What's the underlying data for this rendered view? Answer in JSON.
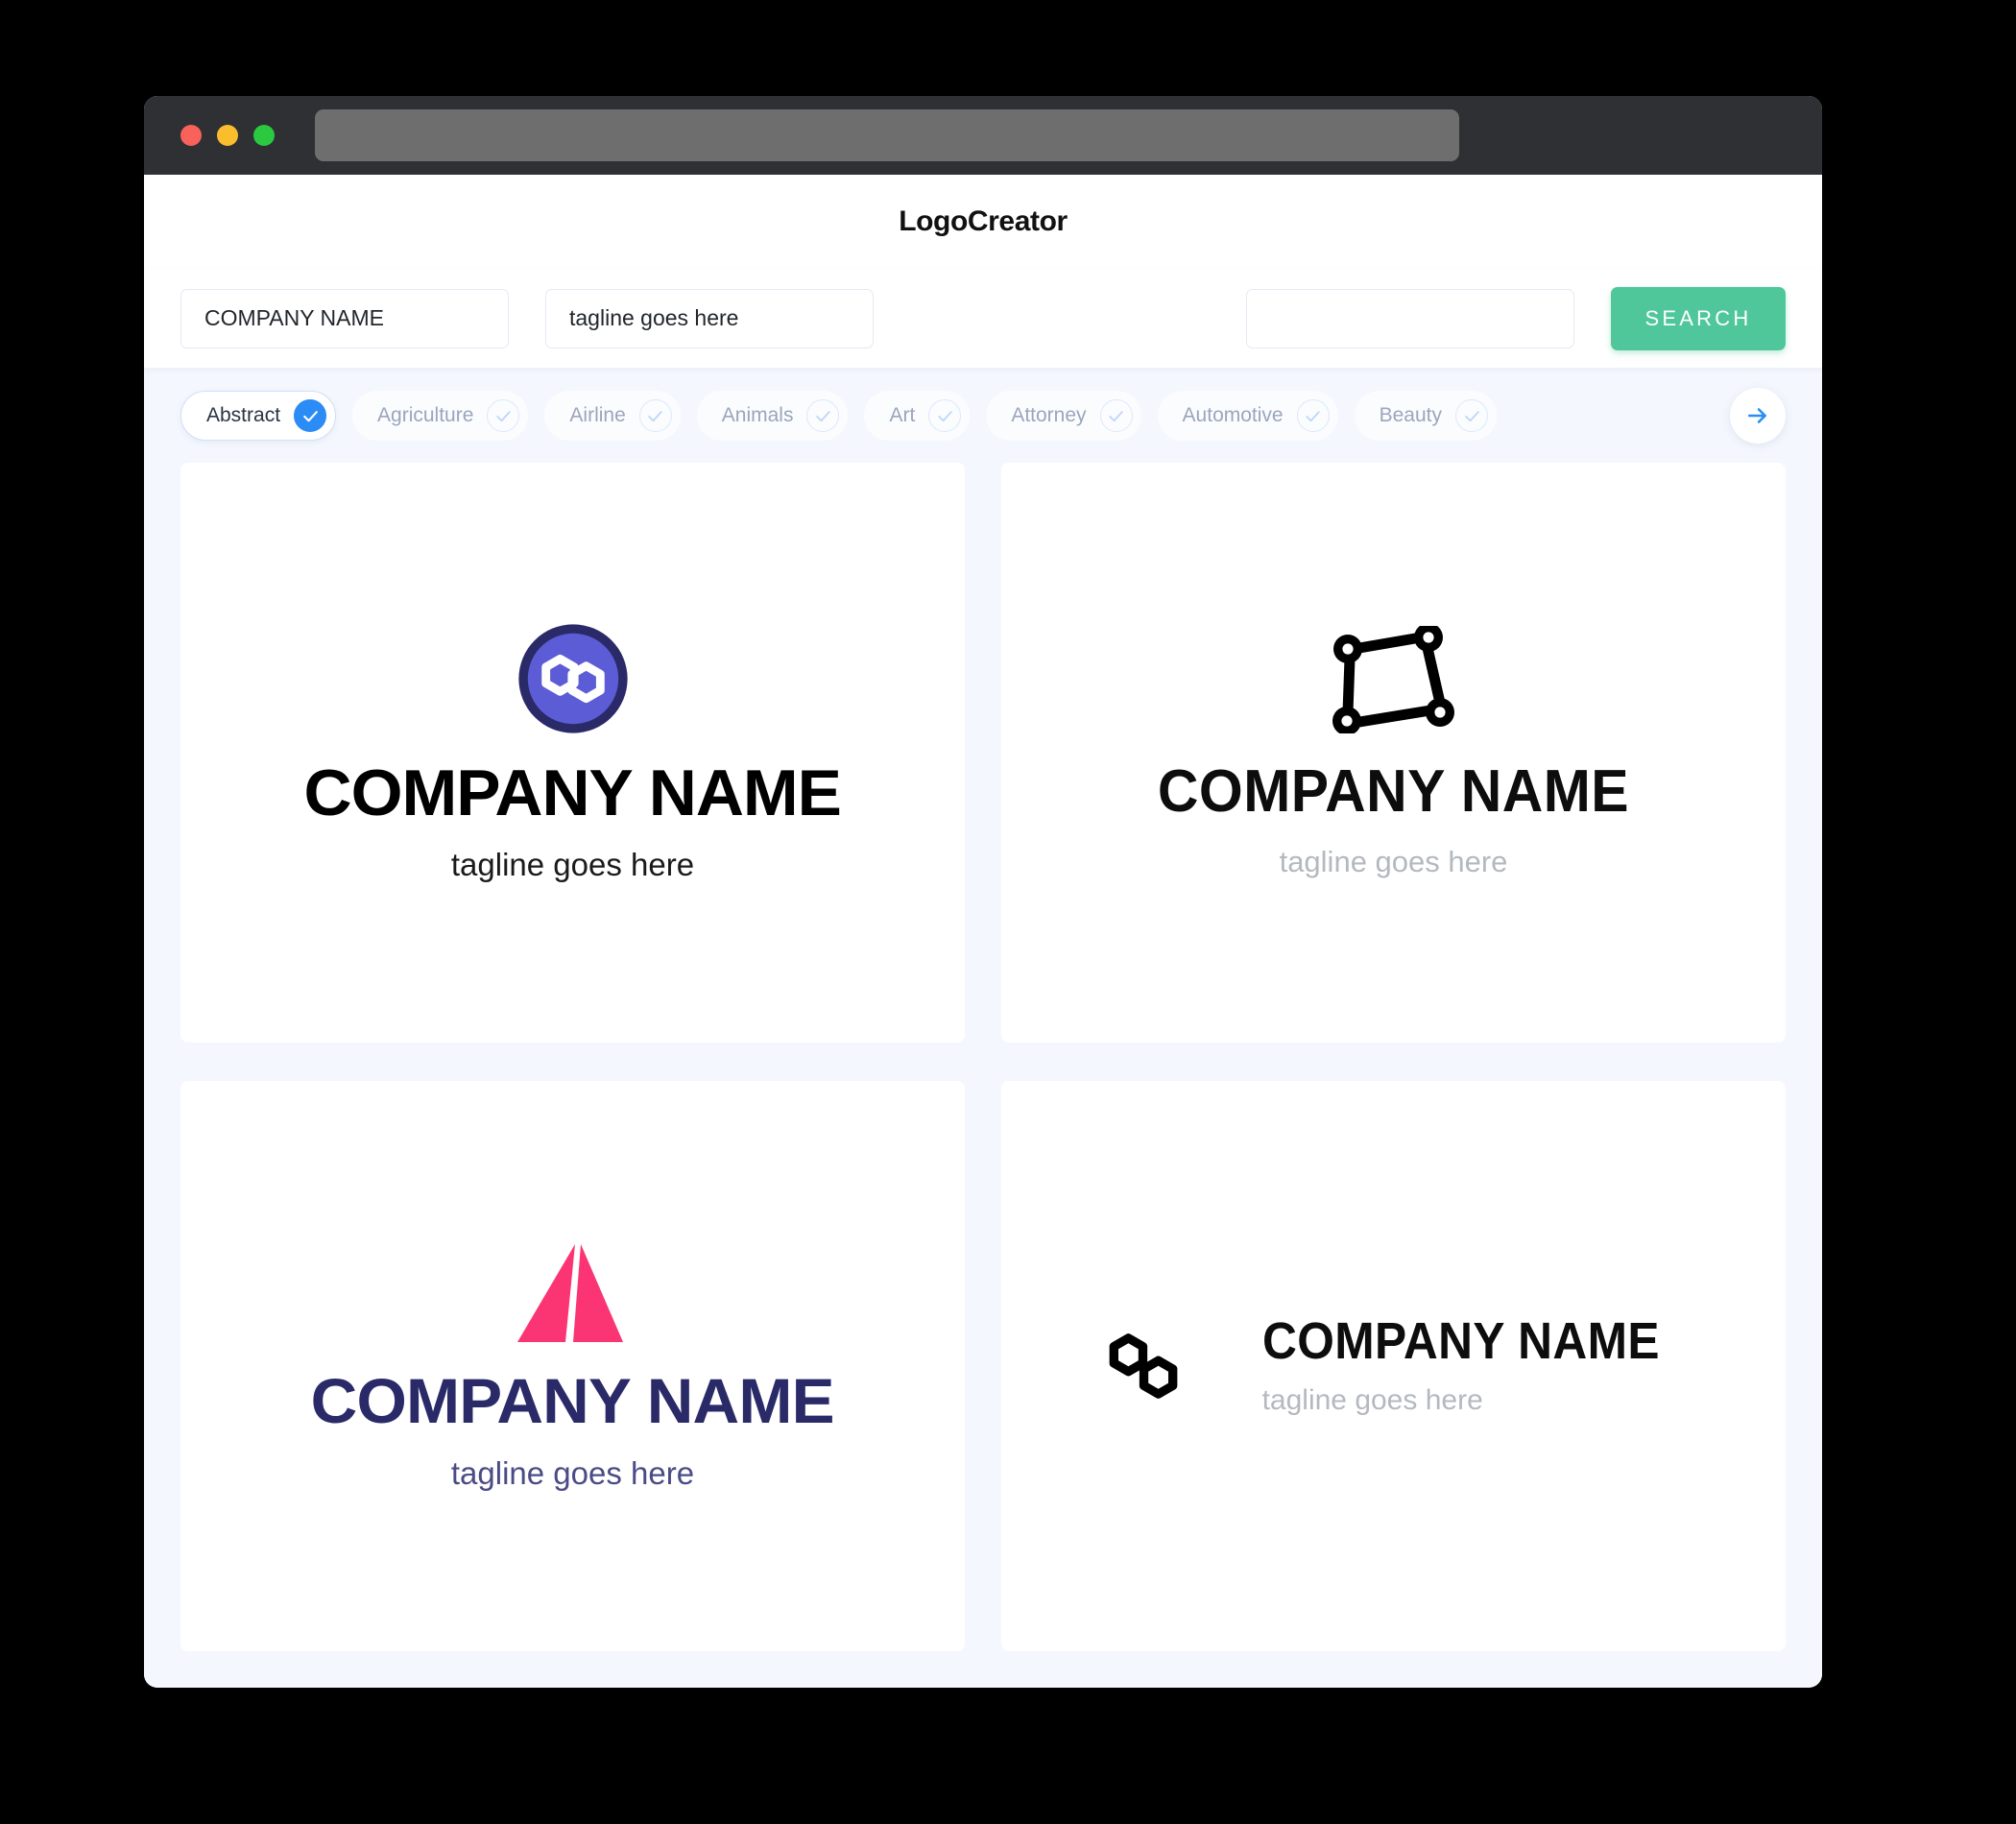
{
  "window": {
    "traffic_lights": [
      "close",
      "minimize",
      "maximize"
    ],
    "url_value": ""
  },
  "header": {
    "app_title": "LogoCreator"
  },
  "search": {
    "company_value": "COMPANY NAME",
    "company_placeholder": "COMPANY NAME",
    "tagline_value": "tagline goes here",
    "tagline_placeholder": "tagline goes here",
    "extra_value": "",
    "extra_placeholder": "",
    "search_label": "SEARCH",
    "search_button_color": "#4fc79b"
  },
  "categories": {
    "selected": "Abstract",
    "accent_color": "#2b8cf5",
    "next_label": "next-arrow",
    "items": [
      {
        "label": "Abstract",
        "selected": true
      },
      {
        "label": "Agriculture",
        "selected": false
      },
      {
        "label": "Airline",
        "selected": false
      },
      {
        "label": "Animals",
        "selected": false
      },
      {
        "label": "Art",
        "selected": false
      },
      {
        "label": "Attorney",
        "selected": false
      },
      {
        "label": "Automotive",
        "selected": false
      },
      {
        "label": "Beauty",
        "selected": false
      }
    ]
  },
  "results": [
    {
      "icon": "polygon-circle-badge-icon",
      "layout": "stacked",
      "company_name": "COMPANY NAME",
      "tagline": "tagline goes here",
      "mark_colors": {
        "ring": "#2b2a68",
        "fill": "#5c5cd6",
        "glyph": "#ffffff"
      },
      "name_color": "#000000",
      "tagline_color": "#1a1a1a"
    },
    {
      "icon": "network-nodes-quad-icon",
      "layout": "stacked",
      "company_name": "COMPANY NAME",
      "tagline": "tagline goes here",
      "mark_colors": {
        "glyph": "#000000"
      },
      "name_color": "#0d0d0d",
      "tagline_color": "#b4b9bf"
    },
    {
      "icon": "split-triangle-icon",
      "layout": "stacked",
      "company_name": "COMPANY NAME",
      "tagline": "tagline goes here",
      "mark_colors": {
        "glyph": "#fb3573"
      },
      "name_color": "#2b2a68",
      "tagline_color": "#4b4b86"
    },
    {
      "icon": "double-hexagon-outline-icon",
      "layout": "horizontal",
      "company_name": "COMPANY NAME",
      "tagline": "tagline goes here",
      "mark_colors": {
        "glyph": "#000000"
      },
      "name_color": "#0d0d0d",
      "tagline_color": "#b4b9bf"
    }
  ]
}
